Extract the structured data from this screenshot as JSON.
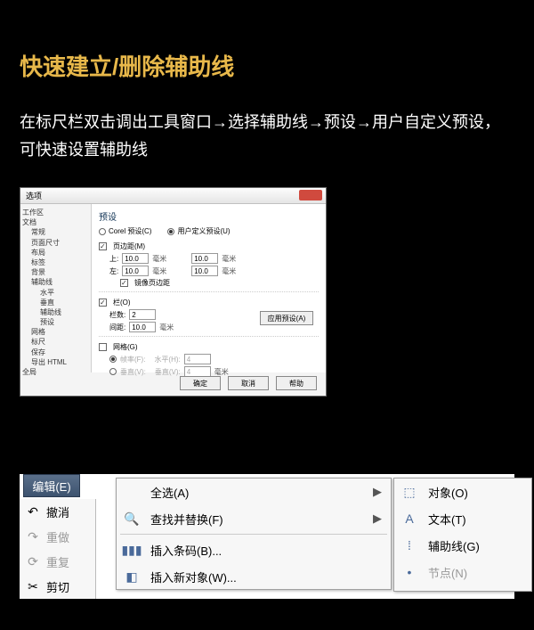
{
  "page": {
    "title": "快速建立/删除辅助线",
    "description": "在标尺栏双击调出工具窗口→选择辅助线→预设→用户自定义预设，可快速设置辅助线"
  },
  "dialog": {
    "title": "选项",
    "tree": {
      "items": [
        "工作区",
        "文档",
        "常规",
        "页面尺寸",
        "布局",
        "标签",
        "背景",
        "辅助线",
        "水平",
        "垂直",
        "辅助线",
        "预设",
        "网格",
        "标尺",
        "保存",
        "导出 HTML",
        "全局"
      ]
    },
    "panel": {
      "heading": "预设",
      "radio1": "Corel 预设(C)",
      "radio2": "用户定义预设(U)",
      "margins_chk": "页边距(M)",
      "top_label": "上:",
      "top_val": "10.0",
      "left_label": "左:",
      "left_val": "10.0",
      "left_val2": "10.0",
      "unit": "毫米",
      "mirror_chk": "镜像页边距",
      "columns_chk": "栏(O)",
      "cols_label": "栏数:",
      "cols_val": "2",
      "gap_label": "间距:",
      "gap_val": "10.0",
      "grid_chk": "网格(G)",
      "hframe": "帧率(F):",
      "vframe": "垂直(V):",
      "hval": "4",
      "vval": "4",
      "apply": "应用预设(A)"
    },
    "buttons": {
      "ok": "确定",
      "cancel": "取消",
      "help": "帮助"
    }
  },
  "bottom": {
    "edit_menu": "编辑(E)",
    "toolbar": {
      "undo": "撤消",
      "redo": "重做",
      "repeat": "重复",
      "cut": "剪切"
    },
    "submenu": {
      "select_all": "全选(A)",
      "find_replace": "查找并替换(F)",
      "insert_barcode": "插入条码(B)...",
      "insert_object": "插入新对象(W)..."
    },
    "submenu2": {
      "object": "对象(O)",
      "text": "文本(T)",
      "guide": "辅助线(G)",
      "node": "节点(N)"
    }
  }
}
